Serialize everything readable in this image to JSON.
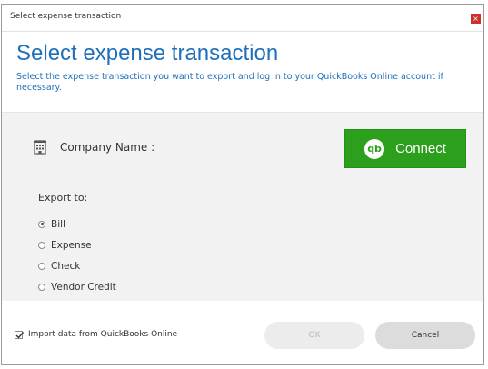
{
  "window": {
    "title": "Select expense transaction",
    "close_glyph": "×"
  },
  "header": {
    "title": "Select expense transaction",
    "subtitle": "Select the expense transaction you want to export and log in to your QuickBooks Online account if necessary."
  },
  "company": {
    "label": "Company Name :",
    "icon": "building-icon"
  },
  "connect": {
    "label": "Connect",
    "logo_text": "qb",
    "color": "#2ca01c"
  },
  "export": {
    "label": "Export to:",
    "options": [
      {
        "label": "Bill",
        "checked": true
      },
      {
        "label": "Expense",
        "checked": false
      },
      {
        "label": "Check",
        "checked": false
      },
      {
        "label": "Vendor Credit",
        "checked": false
      }
    ]
  },
  "footer": {
    "import_label": "Import data from QuickBooks Online",
    "import_checked": true,
    "ok_label": "OK",
    "cancel_label": "Cancel"
  },
  "colors": {
    "accent": "#1f6fba",
    "connect_green": "#2ca01c",
    "close_red": "#c9332b"
  }
}
